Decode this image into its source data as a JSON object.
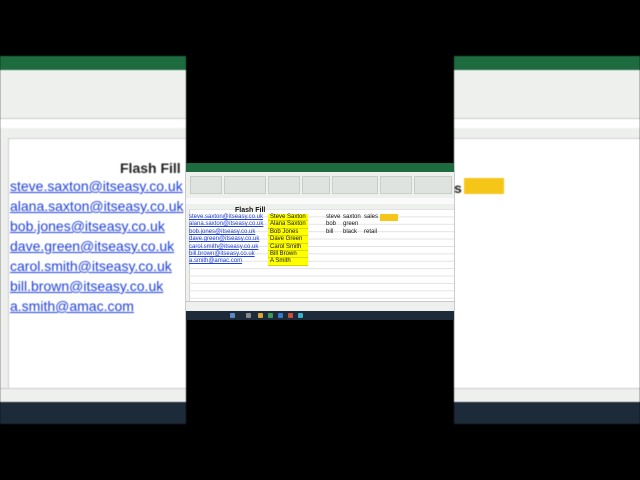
{
  "left_panel": {
    "title": "Flash Fill",
    "emails": [
      "steve.saxton@itseasy.co.uk",
      "alana.saxton@itseasy.co.uk",
      "bob.jones@itseasy.co.uk",
      "dave.green@itseasy.co.uk",
      "carol.smith@itseasy.co.uk",
      "bill.brown@itseasy.co.uk",
      "a.smith@amac.com"
    ]
  },
  "right_panel": {
    "partial_text": "s"
  },
  "sheet": {
    "title": "Flash Fill",
    "emails": [
      "steve.saxton@itseasy.co.uk",
      "alana.saxton@itseasy.co.uk",
      "bob.jones@itseasy.co.uk",
      "dave.green@itseasy.co.uk",
      "carol.smith@itseasy.co.uk",
      "bill.brown@itseasy.co.uk",
      "a.smith@amac.com"
    ],
    "names": [
      "Steve Saxton",
      "Alana Saxton",
      "Bob Jones",
      "Dave Green",
      "Carol Smith",
      "Bill Brown",
      "A Smith"
    ],
    "split_col1": [
      "steve",
      "bob",
      "bill"
    ],
    "split_col2": [
      "saxton",
      "green",
      "black"
    ],
    "split_col3": [
      "sales",
      "",
      "retail"
    ]
  },
  "colors": {
    "excel_green": "#1f6b40",
    "link_blue": "#1e3fd8",
    "highlight_yellow": "#ffff00",
    "accent_gold": "#f5c518",
    "taskbar": "#1c2a3a"
  }
}
